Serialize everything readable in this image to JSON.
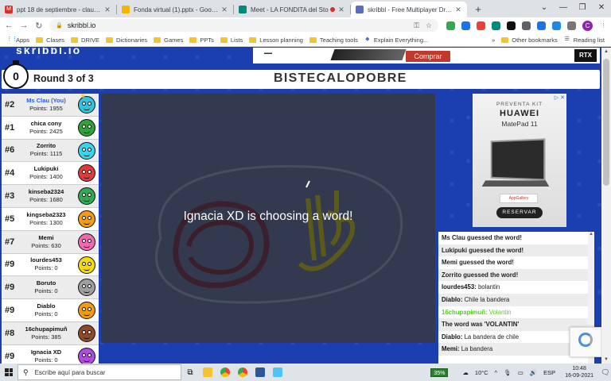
{
  "browser": {
    "tabs": [
      {
        "title": "ppt 18 de septiembre - claudia.a",
        "favicon_color": "#d93025",
        "favicon_letter": "M",
        "active": false
      },
      {
        "title": "Fonda virtual (1).pptx - Google D",
        "favicon_color": "#f4b400",
        "favicon_letter": "",
        "active": false
      },
      {
        "title": "Meet - LA FONDITA del Sto",
        "favicon_color": "#00897b",
        "favicon_letter": "",
        "active": false,
        "recording": true
      },
      {
        "title": "skribbl - Free Multiplayer Drawin",
        "favicon_color": "#5c6bc0",
        "favicon_letter": "",
        "active": true
      }
    ],
    "new_tab": "+",
    "url": "skribbl.io",
    "bookmarks": [
      {
        "label": "Apps",
        "type": "grid"
      },
      {
        "label": "Clases",
        "type": "folder"
      },
      {
        "label": "DRIVE",
        "type": "folder"
      },
      {
        "label": "Dictionaries",
        "type": "folder"
      },
      {
        "label": "Games",
        "type": "folder"
      },
      {
        "label": "PPTs",
        "type": "folder"
      },
      {
        "label": "Lists",
        "type": "folder"
      },
      {
        "label": "Lesson planning",
        "type": "folder"
      },
      {
        "label": "Teaching tools",
        "type": "folder"
      },
      {
        "label": "Explain Everything...",
        "type": "link"
      }
    ],
    "bookmarks_overflow": "»",
    "other_bookmarks": "Other bookmarks",
    "reading_list": "Reading list",
    "profile_initial": "C"
  },
  "game": {
    "round_label": "Round 3 of 3",
    "timer": "0",
    "word": "BISTECALOPOBRE",
    "canvas_message": "Ignacia XD is choosing a word!",
    "players": [
      {
        "rank": "#2",
        "name": "Ms Clau (You)",
        "points": "Points: 1955",
        "color": "#2fc4e0",
        "me": true,
        "crown": true
      },
      {
        "rank": "#1",
        "name": "chica cony",
        "points": "Points: 2425",
        "color": "#2fa33a"
      },
      {
        "rank": "#6",
        "name": "Zorrito",
        "points": "Points: 1115",
        "color": "#35d6f0"
      },
      {
        "rank": "#4",
        "name": "Lukipuki",
        "points": "Points: 1400",
        "color": "#e03b3b"
      },
      {
        "rank": "#3",
        "name": "kinseba2324",
        "points": "Points: 1680",
        "color": "#34a853"
      },
      {
        "rank": "#5",
        "name": "kingseba2323",
        "points": "Points: 1300",
        "color": "#f39c12"
      },
      {
        "rank": "#7",
        "name": "Memi",
        "points": "Points: 630",
        "color": "#f06ab0"
      },
      {
        "rank": "#9",
        "name": "lourdes453",
        "points": "Points: 0",
        "color": "#f5d90a"
      },
      {
        "rank": "#9",
        "name": "Boruto",
        "points": "Points: 0",
        "color": "#9e9e9e"
      },
      {
        "rank": "#9",
        "name": "Diablo",
        "points": "Points: 0",
        "color": "#f39c12"
      },
      {
        "rank": "#8",
        "name": "16chupapimuñ",
        "points": "Points: 385",
        "color": "#8d4b2a"
      },
      {
        "rank": "#9",
        "name": "Ignacia XD",
        "points": "Points: 0",
        "color": "#b04be0"
      }
    ],
    "chat": [
      {
        "style": "green",
        "who": "",
        "text": "Ms Clau guessed the word!"
      },
      {
        "style": "green",
        "who": "",
        "text": "Lukipuki guessed the word!"
      },
      {
        "style": "green",
        "who": "",
        "text": "Memi guessed the word!"
      },
      {
        "style": "green",
        "who": "",
        "text": "Zorrito guessed the word!"
      },
      {
        "style": "normal",
        "who": "lourdes453:",
        "text": "bolantin"
      },
      {
        "style": "normal",
        "who": "Diablo:",
        "text": "Chile la bandera"
      },
      {
        "style": "lgreen",
        "who": "16chupapimuñ:",
        "text": "Volantin"
      },
      {
        "style": "green",
        "who": "",
        "text": "The word was 'VOLANTIN'"
      },
      {
        "style": "normal",
        "who": "Diablo:",
        "text": "La bandera de chile"
      },
      {
        "style": "normal",
        "who": "Memi:",
        "text": "La bandera"
      }
    ]
  },
  "ads": {
    "top_button": "Comprar",
    "top_badge": "RTX",
    "top_sub": "GEFORCE",
    "side_preventa": "PREVENTA KIT",
    "side_brand": "HUAWEI",
    "side_model": "MatePad 11",
    "side_gallery": "AppGallery",
    "side_cta": "RESERVAR",
    "side_close": "▷ ✕"
  },
  "taskbar": {
    "search_placeholder": "Escribe aquí para buscar",
    "battery": "35%",
    "weather": "10°C",
    "language": "ESP",
    "time": "10:48",
    "date": "16-09-2021"
  },
  "colors": {
    "page_bg": "#1b3fb0",
    "canvas_bg": "#333a4f",
    "guess_green": "#3fb618"
  }
}
